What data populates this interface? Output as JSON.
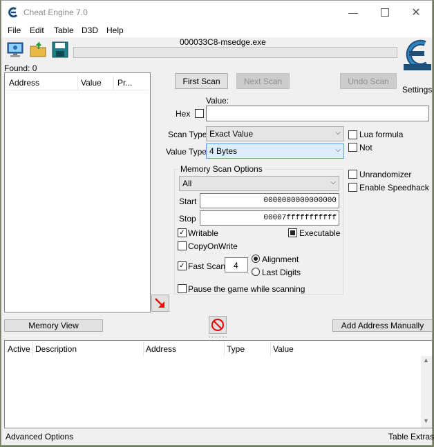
{
  "window": {
    "title": "Cheat Engine 7.0",
    "process": "000033C8-msedge.exe",
    "found": "Found: 0"
  },
  "menu": [
    "File",
    "Edit",
    "Table",
    "D3D",
    "Help"
  ],
  "found_list": {
    "columns": [
      "Address",
      "Value",
      "Pr..."
    ]
  },
  "scan": {
    "first_scan": "First Scan",
    "next_scan": "Next Scan",
    "undo_scan": "Undo Scan",
    "settings": "Settings",
    "value_label": "Value:",
    "hex_label": "Hex",
    "value_input": "",
    "scan_type_label": "Scan Type",
    "scan_type": "Exact Value",
    "value_type_label": "Value Type",
    "value_type": "4 Bytes",
    "lua_formula": "Lua formula",
    "not_label": "Not",
    "unrandomizer": "Unrandomizer",
    "enable_speedhack": "Enable Speedhack"
  },
  "memory_options": {
    "title": "Memory Scan Options",
    "region": "All",
    "start_label": "Start",
    "start": "0000000000000000",
    "stop_label": "Stop",
    "stop": "00007fffffffffff",
    "writable": "Writable",
    "writable_checked": true,
    "executable": "Executable",
    "executable_state": "indeterminate",
    "copy_on_write": "CopyOnWrite",
    "copy_on_write_checked": false,
    "fast_scan": "Fast Scan",
    "fast_scan_checked": true,
    "fast_scan_value": "4",
    "alignment": "Alignment",
    "last_digits": "Last Digits",
    "alignment_selected": true,
    "pause_game": "Pause the game while scanning",
    "pause_checked": false
  },
  "bottom": {
    "memory_view": "Memory View",
    "add_address": "Add Address Manually",
    "columns": [
      "Active",
      "Description",
      "Address",
      "Type",
      "Value"
    ],
    "advanced_options": "Advanced Options",
    "table_extras": "Table Extras"
  }
}
